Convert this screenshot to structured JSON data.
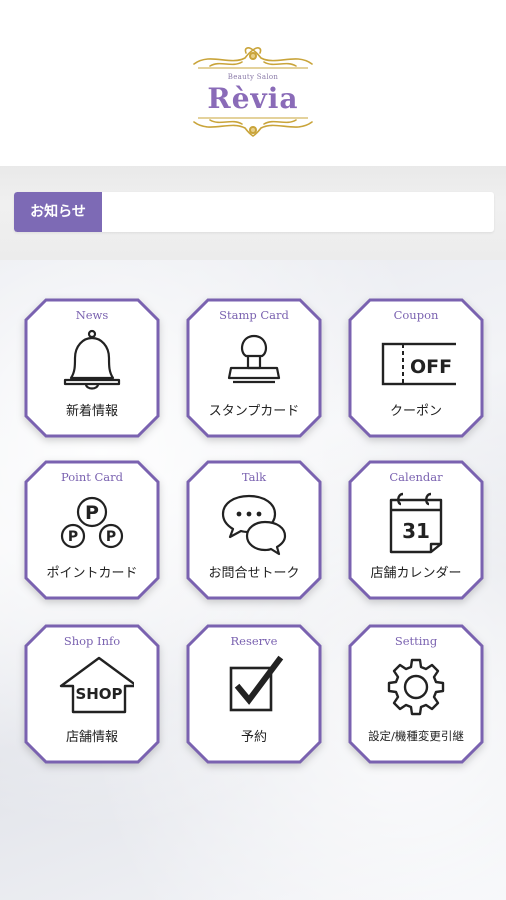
{
  "header": {
    "logo_small": "Beauty Salon",
    "logo_name": "Rèvia"
  },
  "news": {
    "label": "お知らせ",
    "content": ""
  },
  "colors": {
    "accent": "#7d6ab5",
    "tile_border": "#7a62b0",
    "gold": "#c9a43a"
  },
  "menu": [
    {
      "title": "News",
      "label": "新着情報",
      "icon": "bell-icon"
    },
    {
      "title": "Stamp Card",
      "label": "スタンプカード",
      "icon": "stamp-icon"
    },
    {
      "title": "Coupon",
      "label": "クーポン",
      "icon": "off-coupon-icon",
      "icon_text": "OFF"
    },
    {
      "title": "Point Card",
      "label": "ポイントカード",
      "icon": "points-icon",
      "icon_text": "P"
    },
    {
      "title": "Talk",
      "label": "お問合せトーク",
      "icon": "chat-bubbles-icon"
    },
    {
      "title": "Calendar",
      "label": "店舗カレンダー",
      "icon": "calendar-icon",
      "icon_text": "31"
    },
    {
      "title": "Shop Info",
      "label": "店舗情報",
      "icon": "shop-icon",
      "icon_text": "SHOP"
    },
    {
      "title": "Reserve",
      "label": "予約",
      "icon": "checkbox-icon"
    },
    {
      "title": "Setting",
      "label": "設定/機種変更引継",
      "icon": "gear-icon"
    }
  ]
}
